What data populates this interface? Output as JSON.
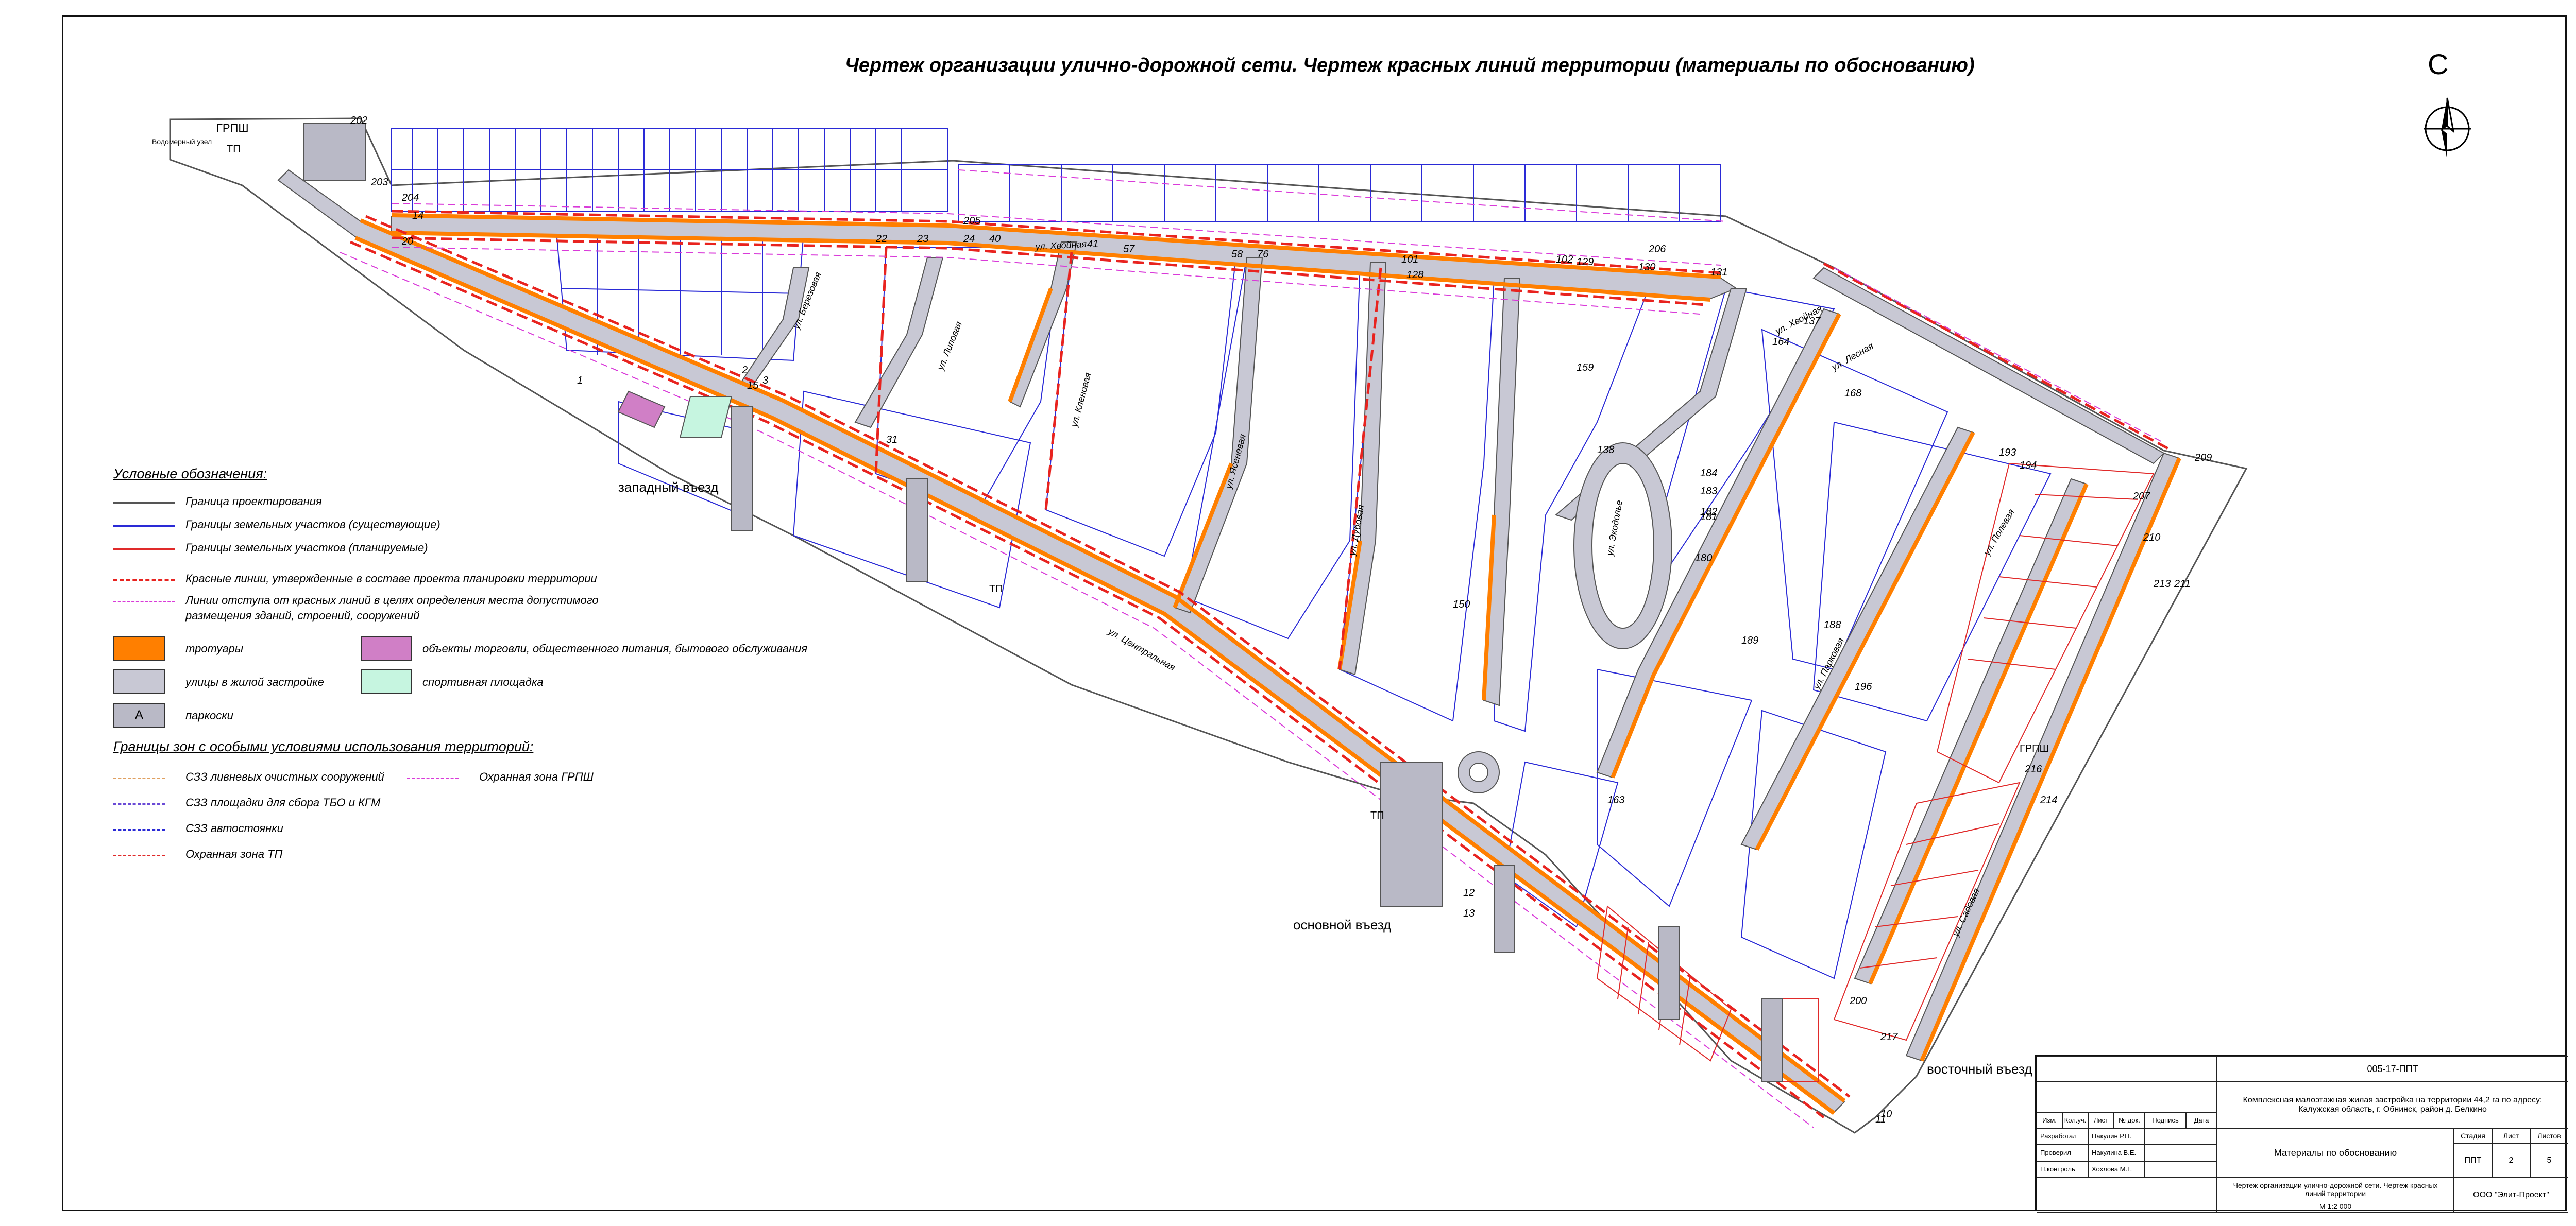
{
  "title": "Чертеж организации улично-дорожной сети. Чертеж красных линий территории (материалы по обоснованию)",
  "north_label": "С",
  "colors": {
    "boundary": "#555555",
    "parcel_existing": "#2a2ad6",
    "parcel_planned": "#e02a2a",
    "red_line": "#e8231f",
    "setback_line": "#d93ad9",
    "sidewalk": "#ff7f00",
    "street": "#c8c8d4",
    "parking": "#b9b9c6",
    "commerce": "#d07fc6",
    "sport": "#c6f5e0"
  },
  "legend": {
    "title": "Условные обозначения:",
    "items": [
      "Граница проектирования",
      "Границы земельных участков (существующие)",
      "Границы земельных участков (планируемые)",
      "Красные линии, утвержденные в составе проекта планировки территории",
      "Линии отступа от красных линий в целях определения места допустимого",
      "размещения зданий, строений, сооружений",
      "тротуары",
      "объекты торговли, общественного питания, бытового обслуживания",
      "улицы в жилой застройке",
      "спортивная площадка",
      "паркоски"
    ],
    "parking_symbol": "A",
    "zones_title": "Границы зон с особыми условиями использования территорий:",
    "zones": [
      "СЗЗ ливневых очистных сооружений",
      "Охранная зона ГРПШ",
      "СЗЗ площадки для сбора ТБО и КГМ",
      "СЗЗ автостоянки",
      "Охранная зона ТП"
    ]
  },
  "map_labels": {
    "entry_west": "западный въезд",
    "entry_main": "основной въезд",
    "entry_east": "восточный въезд",
    "grpsh_top": "ГРПШ",
    "grpsh_right": "ГРПШ",
    "tp1": "ТП",
    "tp2": "ТП",
    "tp3": "ТП",
    "water_zone": "Водомерный узел",
    "street_names": [
      "ул. Хвойная",
      "ул. Хвойная",
      "ул. Березовая",
      "ул. Липовая",
      "ул. Кленовая",
      "ул. Ясеневая",
      "ул. Дубовая",
      "ул. Экодолье",
      "ул. Лесная",
      "ул. Полевая",
      "ул. Парковая",
      "ул. Садовая",
      "ул. Центральная"
    ],
    "point_numbers": [
      "1",
      "2",
      "3",
      "10",
      "11",
      "12",
      "13",
      "14",
      "15",
      "20",
      "22",
      "23",
      "24",
      "31",
      "40",
      "41",
      "57",
      "58",
      "76",
      "101",
      "102",
      "128",
      "129",
      "130",
      "131",
      "137",
      "138",
      "150",
      "159",
      "163",
      "164",
      "168",
      "180",
      "181",
      "182",
      "183",
      "184",
      "188",
      "189",
      "193",
      "194",
      "196",
      "200",
      "202",
      "203",
      "204",
      "205",
      "206",
      "207",
      "209",
      "210",
      "211",
      "213",
      "214",
      "216",
      "217"
    ]
  },
  "stamp": {
    "doc_code": "005-17-ППТ",
    "project": "Комплексная малоэтажная жилая застройка на территории 44,2 га по адресу: Калужская область, г. Обнинск, район д. Белкино",
    "col_headers": [
      "Изм.",
      "Кол.уч.",
      "Лист",
      "№ док.",
      "Подпись",
      "Дата"
    ],
    "roles": [
      "Разработал",
      "Проверил",
      "Н.контроль"
    ],
    "names": [
      "Накулин Р.Н.",
      "Накулина В.Е.",
      "Хохлова М.Г."
    ],
    "section": "Материалы по обоснованию",
    "stage_label": "Стадия",
    "sheet_label": "Лист",
    "sheets_label": "Листов",
    "stage": "ППТ",
    "sheet": "2",
    "sheets": "5",
    "drawing_name": "Чертеж организации улично-дорожной сети. Чертеж красных линий территории",
    "scale": "М 1:2 000",
    "company": "ООО \"Элит-Проект\""
  }
}
